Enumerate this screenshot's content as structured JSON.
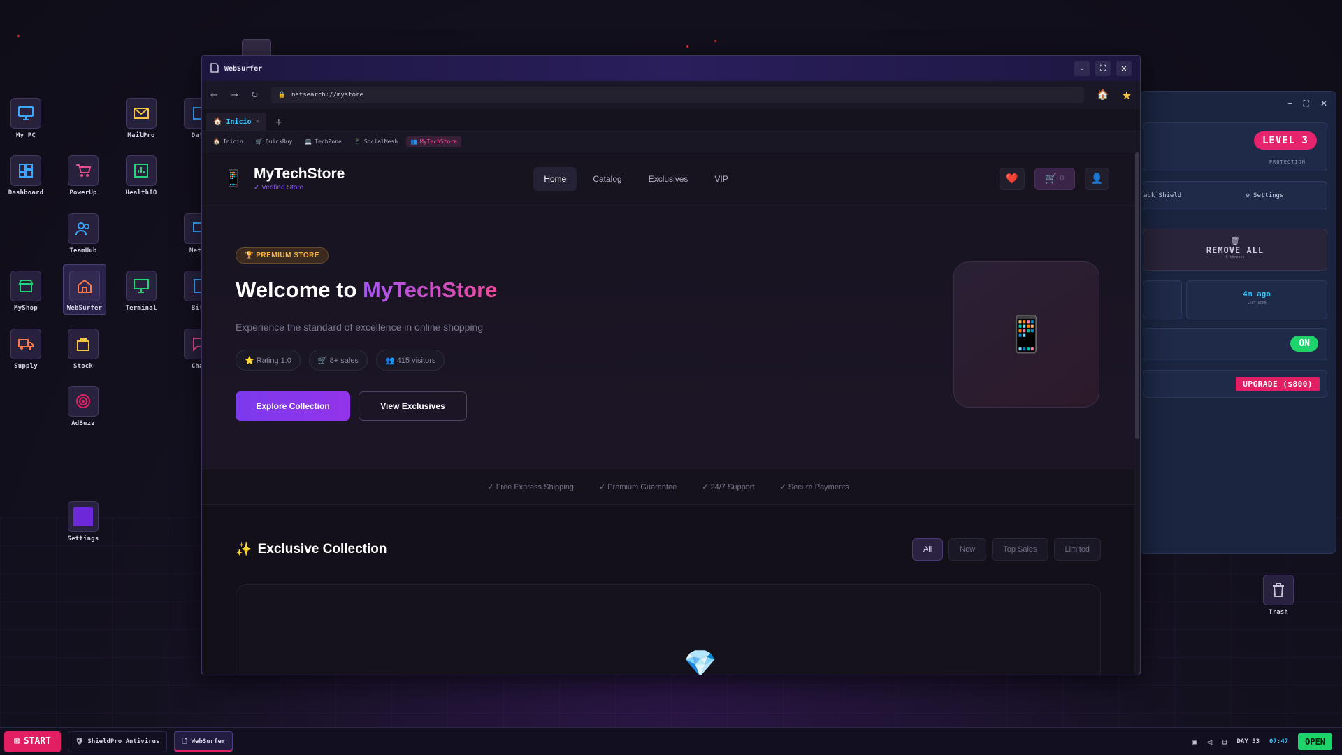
{
  "desktop": {
    "icons": [
      {
        "label": "My PC",
        "icon": "monitor-icon"
      },
      {
        "label": "MailPro",
        "icon": "mail-icon"
      },
      {
        "label": "Data",
        "icon": "data-icon"
      },
      {
        "label": "Dashboard",
        "icon": "dashboard-icon"
      },
      {
        "label": "PowerUp",
        "icon": "cart-icon"
      },
      {
        "label": "HealthIO",
        "icon": "chart-icon"
      },
      {
        "label": "TeamHub",
        "icon": "users-icon"
      },
      {
        "label": "MetaS",
        "icon": "monitor-icon"
      },
      {
        "label": "MyShop",
        "icon": "store-icon"
      },
      {
        "label": "WebSurfer",
        "icon": "home-icon"
      },
      {
        "label": "Terminal",
        "icon": "terminal-icon"
      },
      {
        "label": "Bill",
        "icon": "bill-icon"
      },
      {
        "label": "Supply",
        "icon": "truck-icon"
      },
      {
        "label": "Stock",
        "icon": "bag-icon"
      },
      {
        "label": "Chat",
        "icon": "chat-icon"
      },
      {
        "label": "AdBuzz",
        "icon": "target-icon"
      },
      {
        "label": "Settings",
        "icon": "settings-icon"
      },
      {
        "label": "Trash",
        "icon": "trash-icon"
      }
    ]
  },
  "antivirus": {
    "level": "LEVEL 3",
    "protection": "PROTECTION",
    "menu_left": "ack Shield",
    "menu_settings": "Settings",
    "remove_all": "REMOVE ALL",
    "remove_sub": "0 threats",
    "last_scan_value": "4m ago",
    "last_scan_label": "LAST SCAN",
    "toggle": "ON",
    "upgrade": "UPGRADE ($800)"
  },
  "browser": {
    "title": "WebSurfer",
    "url": "netsearch://mystore",
    "tab": "Inicio",
    "bookmarks": [
      "Inicio",
      "QuickBuy",
      "TechZone",
      "SocialMesh",
      "MyTechStore"
    ]
  },
  "site": {
    "name": "MyTechStore",
    "verified": "✓ Verified Store",
    "nav": [
      "Home",
      "Catalog",
      "Exclusives",
      "VIP"
    ],
    "cart_count": "0",
    "badge": "🏆 PREMIUM STORE",
    "welcome": "Welcome to ",
    "welcome_brand": "MyTechStore",
    "subtitle": "Experience the standard of excellence in online shopping",
    "stats": [
      "⭐ Rating 1.0",
      "🛒 8+ sales",
      "👥 415 visitors"
    ],
    "cta_primary": "Explore Collection",
    "cta_secondary": "View Exclusives",
    "features": [
      "✓ Free Express Shipping",
      "✓ Premium Guarantee",
      "✓ 24/7 Support",
      "✓ Secure Payments"
    ],
    "collection_title": "Exclusive Collection",
    "filters": [
      "All",
      "New",
      "Top Sales",
      "Limited"
    ]
  },
  "taskbar": {
    "start": "START",
    "tasks": [
      "ShieldPro Antivirus",
      "WebSurfer"
    ],
    "day": "DAY 53",
    "time": "07:47",
    "status": "OPEN"
  },
  "colors": {
    "accent": "#8b5cf6",
    "pink": "#ec4899",
    "start": "#e21f63",
    "open": "#1fd36b"
  }
}
